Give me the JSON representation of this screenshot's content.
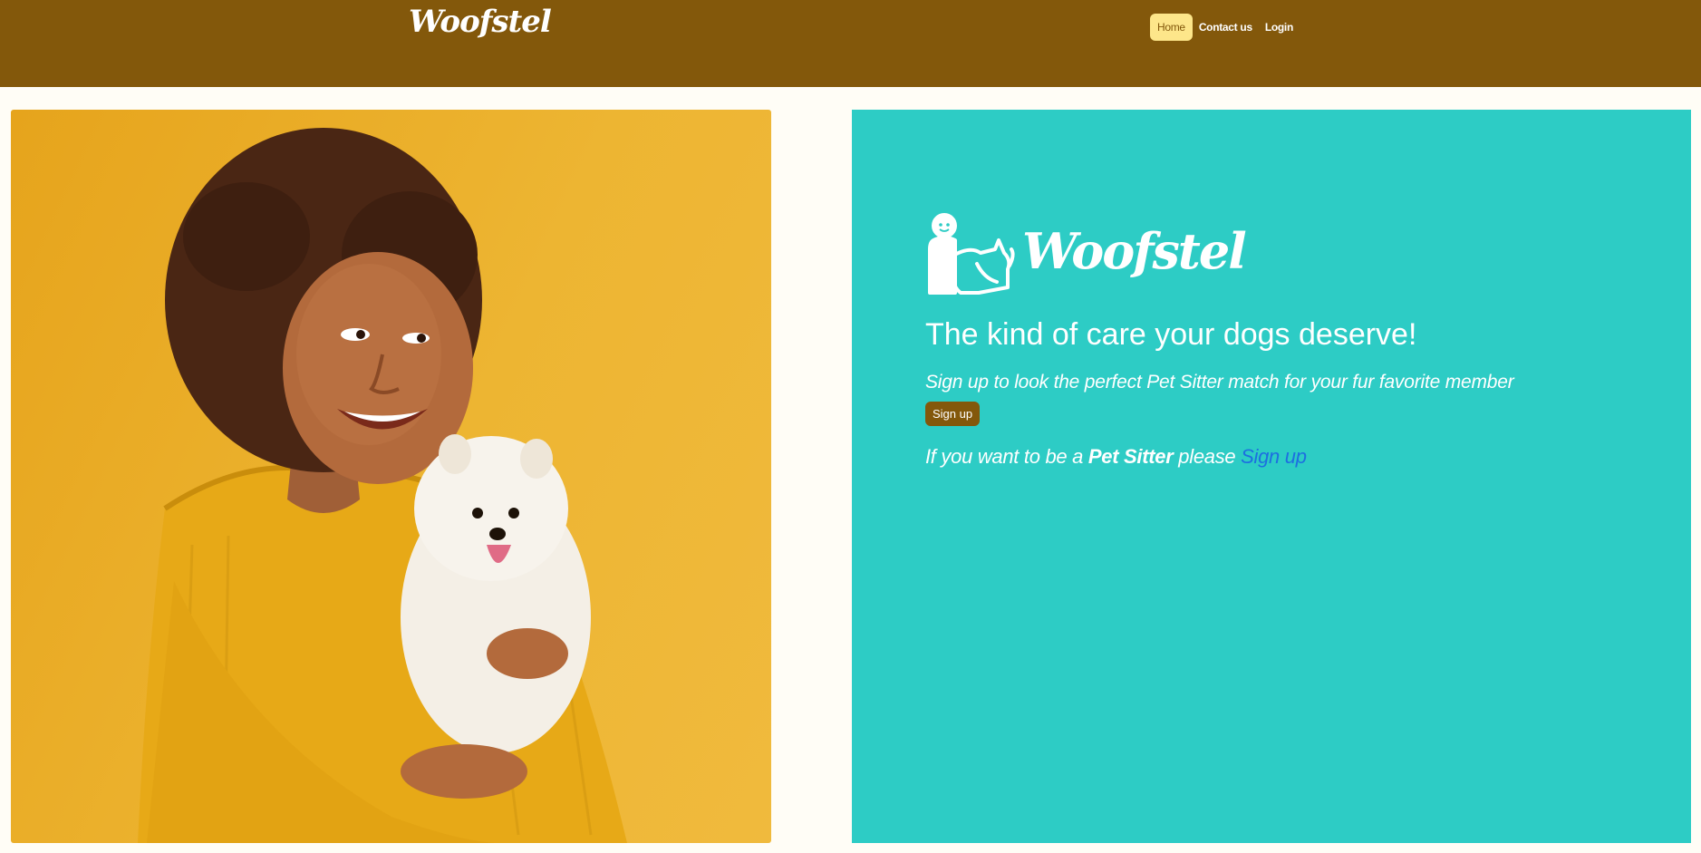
{
  "header": {
    "brand": "Woofstel",
    "nav": {
      "home": "Home",
      "contact": "Contact us",
      "login": "Login"
    }
  },
  "hero": {
    "image_alt": "Smiling woman in a yellow sweater holding a white Pomeranian puppy"
  },
  "panel": {
    "logo_text": "Woofstel",
    "headline": "The kind of care your dogs deserve!",
    "subline": "Sign up to look the perfect Pet Sitter match for your fur favorite member",
    "signup_button": "Sign up",
    "sitter_prefix": "If you want to be a ",
    "sitter_bold": "Pet Sitter",
    "sitter_middle": " please ",
    "sitter_link": "Sign up"
  },
  "colors": {
    "header_bg": "#83580b",
    "page_bg": "#fffdf6",
    "panel_bg": "#2dccc5",
    "active_nav_bg": "#fde68a",
    "link": "#1d6fe0"
  }
}
